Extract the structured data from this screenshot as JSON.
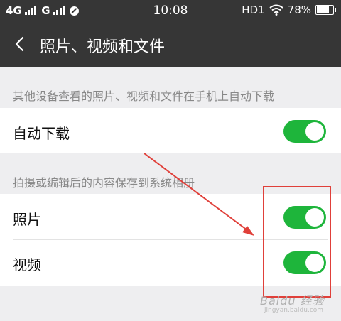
{
  "status_bar": {
    "network1": "4G",
    "network2": "G",
    "time": "10:08",
    "hd": "HD1",
    "battery_level": "78%"
  },
  "nav": {
    "title": "照片、视频和文件"
  },
  "section1": {
    "header": "其他设备查看的照片、视频和文件在手机上自动下载",
    "items": [
      {
        "label": "自动下载",
        "enabled": true
      }
    ]
  },
  "section2": {
    "header": "拍摄或编辑后的内容保存到系统相册",
    "items": [
      {
        "label": "照片",
        "enabled": true
      },
      {
        "label": "视频",
        "enabled": true
      }
    ]
  },
  "watermark": {
    "text": "Baidu 经验",
    "sub": "jingyan.baidu.com"
  },
  "colors": {
    "bar": "#363636",
    "toggle_on": "#1eb53b",
    "annotation": "#e0403a"
  }
}
